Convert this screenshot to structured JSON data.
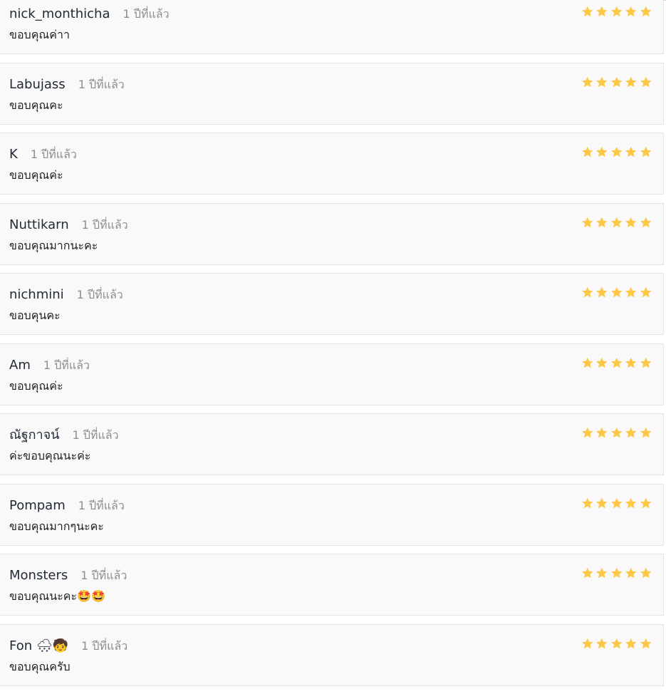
{
  "reviews": [
    {
      "name": "nick_monthicha",
      "time": "1 ปีที่แล้ว",
      "comment": "ขอบคุณค่าา",
      "rating": 5
    },
    {
      "name": "Labujass",
      "time": "1 ปีที่แล้ว",
      "comment": "ขอบคุณคะ",
      "rating": 5
    },
    {
      "name": "K",
      "time": "1 ปีที่แล้ว",
      "comment": "ขอบคุณค่ะ",
      "rating": 5
    },
    {
      "name": "Nuttikarn",
      "time": "1 ปีที่แล้ว",
      "comment": "ขอบคุณมากนะคะ",
      "rating": 5
    },
    {
      "name": "nichmini",
      "time": "1 ปีที่แล้ว",
      "comment": "ขอบคุนคะ",
      "rating": 5
    },
    {
      "name": "Am",
      "time": "1 ปีที่แล้ว",
      "comment": "ขอบคุณค่ะ",
      "rating": 5
    },
    {
      "name": "ณัฐกาจน์",
      "time": "1 ปีที่แล้ว",
      "comment": "ค่ะขอบคุณนะค่ะ",
      "rating": 5
    },
    {
      "name": "Pompam",
      "time": "1 ปีที่แล้ว",
      "comment": "ขอบคุณมากๆนะคะ",
      "rating": 5
    },
    {
      "name": "Monsters",
      "time": "1 ปีที่แล้ว",
      "comment": "ขอบคุณนะคะ🤩🤩",
      "rating": 5
    },
    {
      "name": "Fon 🌨🧒",
      "time": "1 ปีที่แล้ว",
      "comment": "ขอบคุณครับ",
      "rating": 5
    }
  ],
  "colors": {
    "star": "#fdc847",
    "card_bg": "#f9f9f9",
    "card_border": "#e5e5e5",
    "name": "#222a36",
    "time": "#8e8e8e"
  },
  "icons": {
    "rating": "star-icon"
  }
}
